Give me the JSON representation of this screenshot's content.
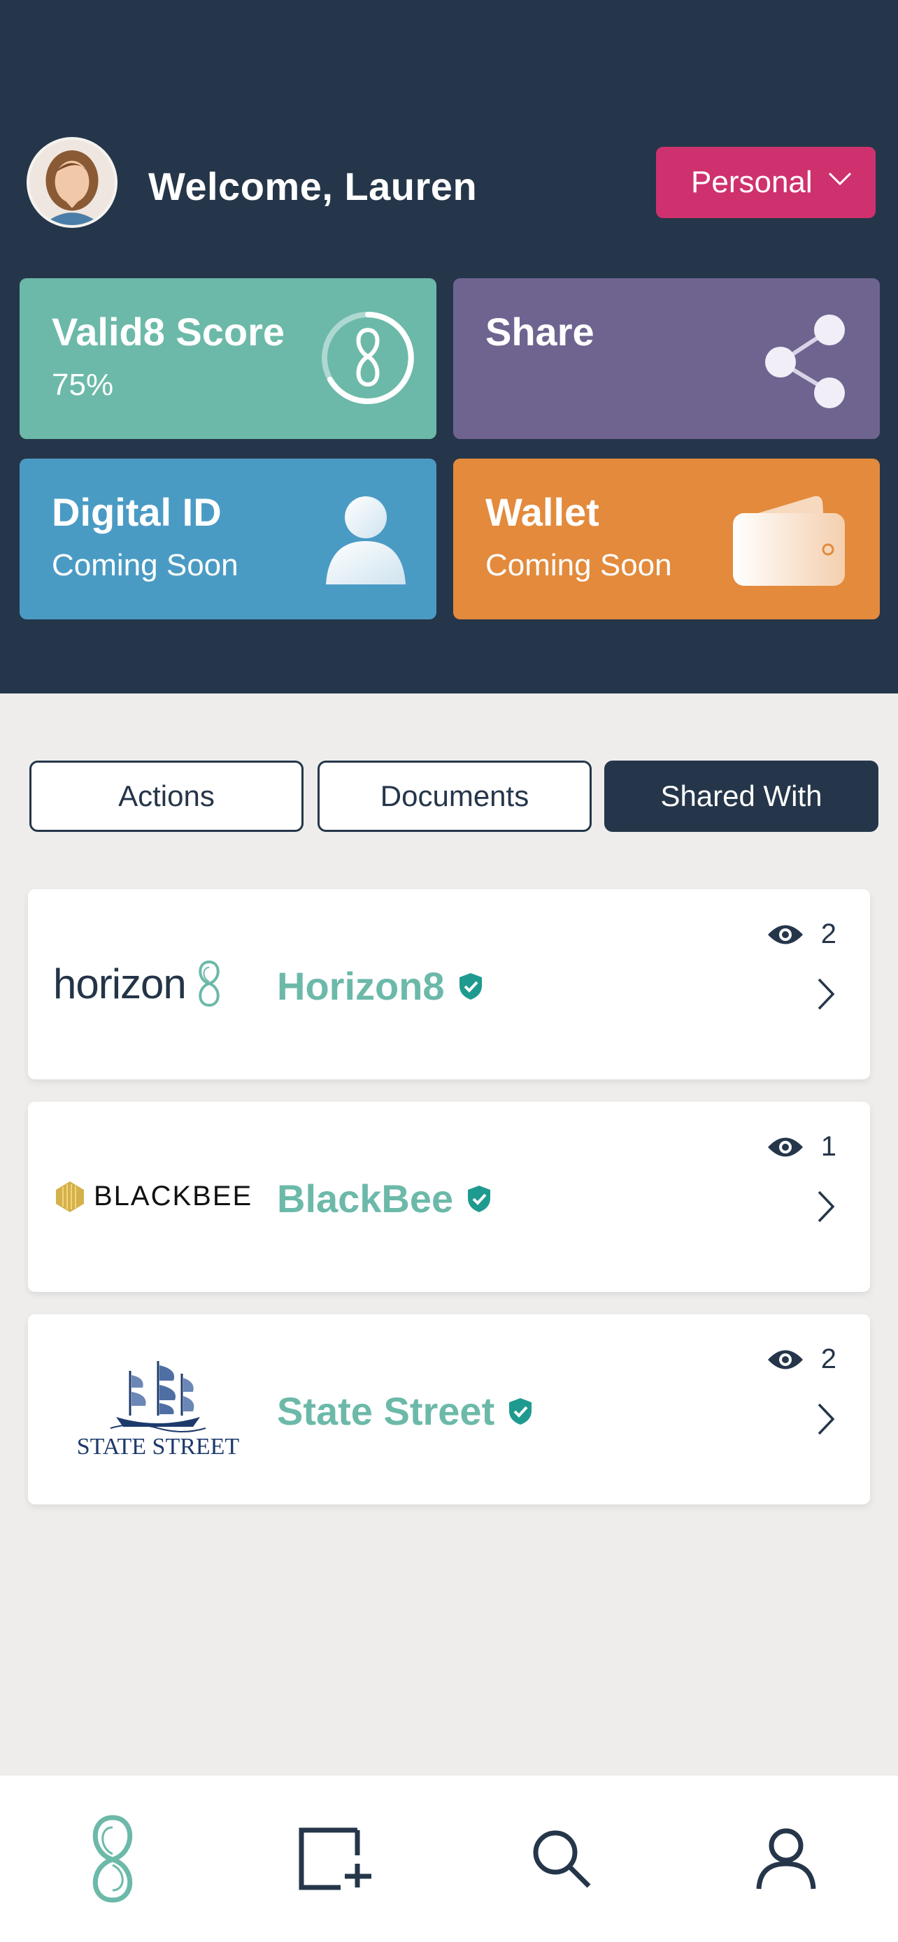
{
  "header": {
    "welcome": "Welcome, Lauren",
    "profile_selector": "Personal"
  },
  "tiles": {
    "score": {
      "title": "Valid8 Score",
      "value": "75%"
    },
    "share": {
      "title": "Share"
    },
    "digital_id": {
      "title": "Digital ID",
      "subtitle": "Coming Soon"
    },
    "wallet": {
      "title": "Wallet",
      "subtitle": "Coming Soon"
    }
  },
  "tabs": [
    {
      "label": "Actions"
    },
    {
      "label": "Documents"
    },
    {
      "label": "Shared With",
      "active": true
    }
  ],
  "shared": [
    {
      "logo": "horizon",
      "name": "Horizon8",
      "views": "2"
    },
    {
      "logo": "BLACKBEE",
      "name": "BlackBee",
      "views": "1"
    },
    {
      "logo": "STATE STREET",
      "name": "State Street",
      "views": "2"
    }
  ],
  "nav": [
    "valid8-logo-icon",
    "add-document-icon",
    "search-icon",
    "profile-icon"
  ],
  "colors": {
    "header_bg": "#25364a",
    "teal": "#6cb9a9",
    "purple": "#6f648f",
    "blue": "#4a9bc4",
    "orange": "#e38a3c",
    "pink": "#cf316e"
  }
}
